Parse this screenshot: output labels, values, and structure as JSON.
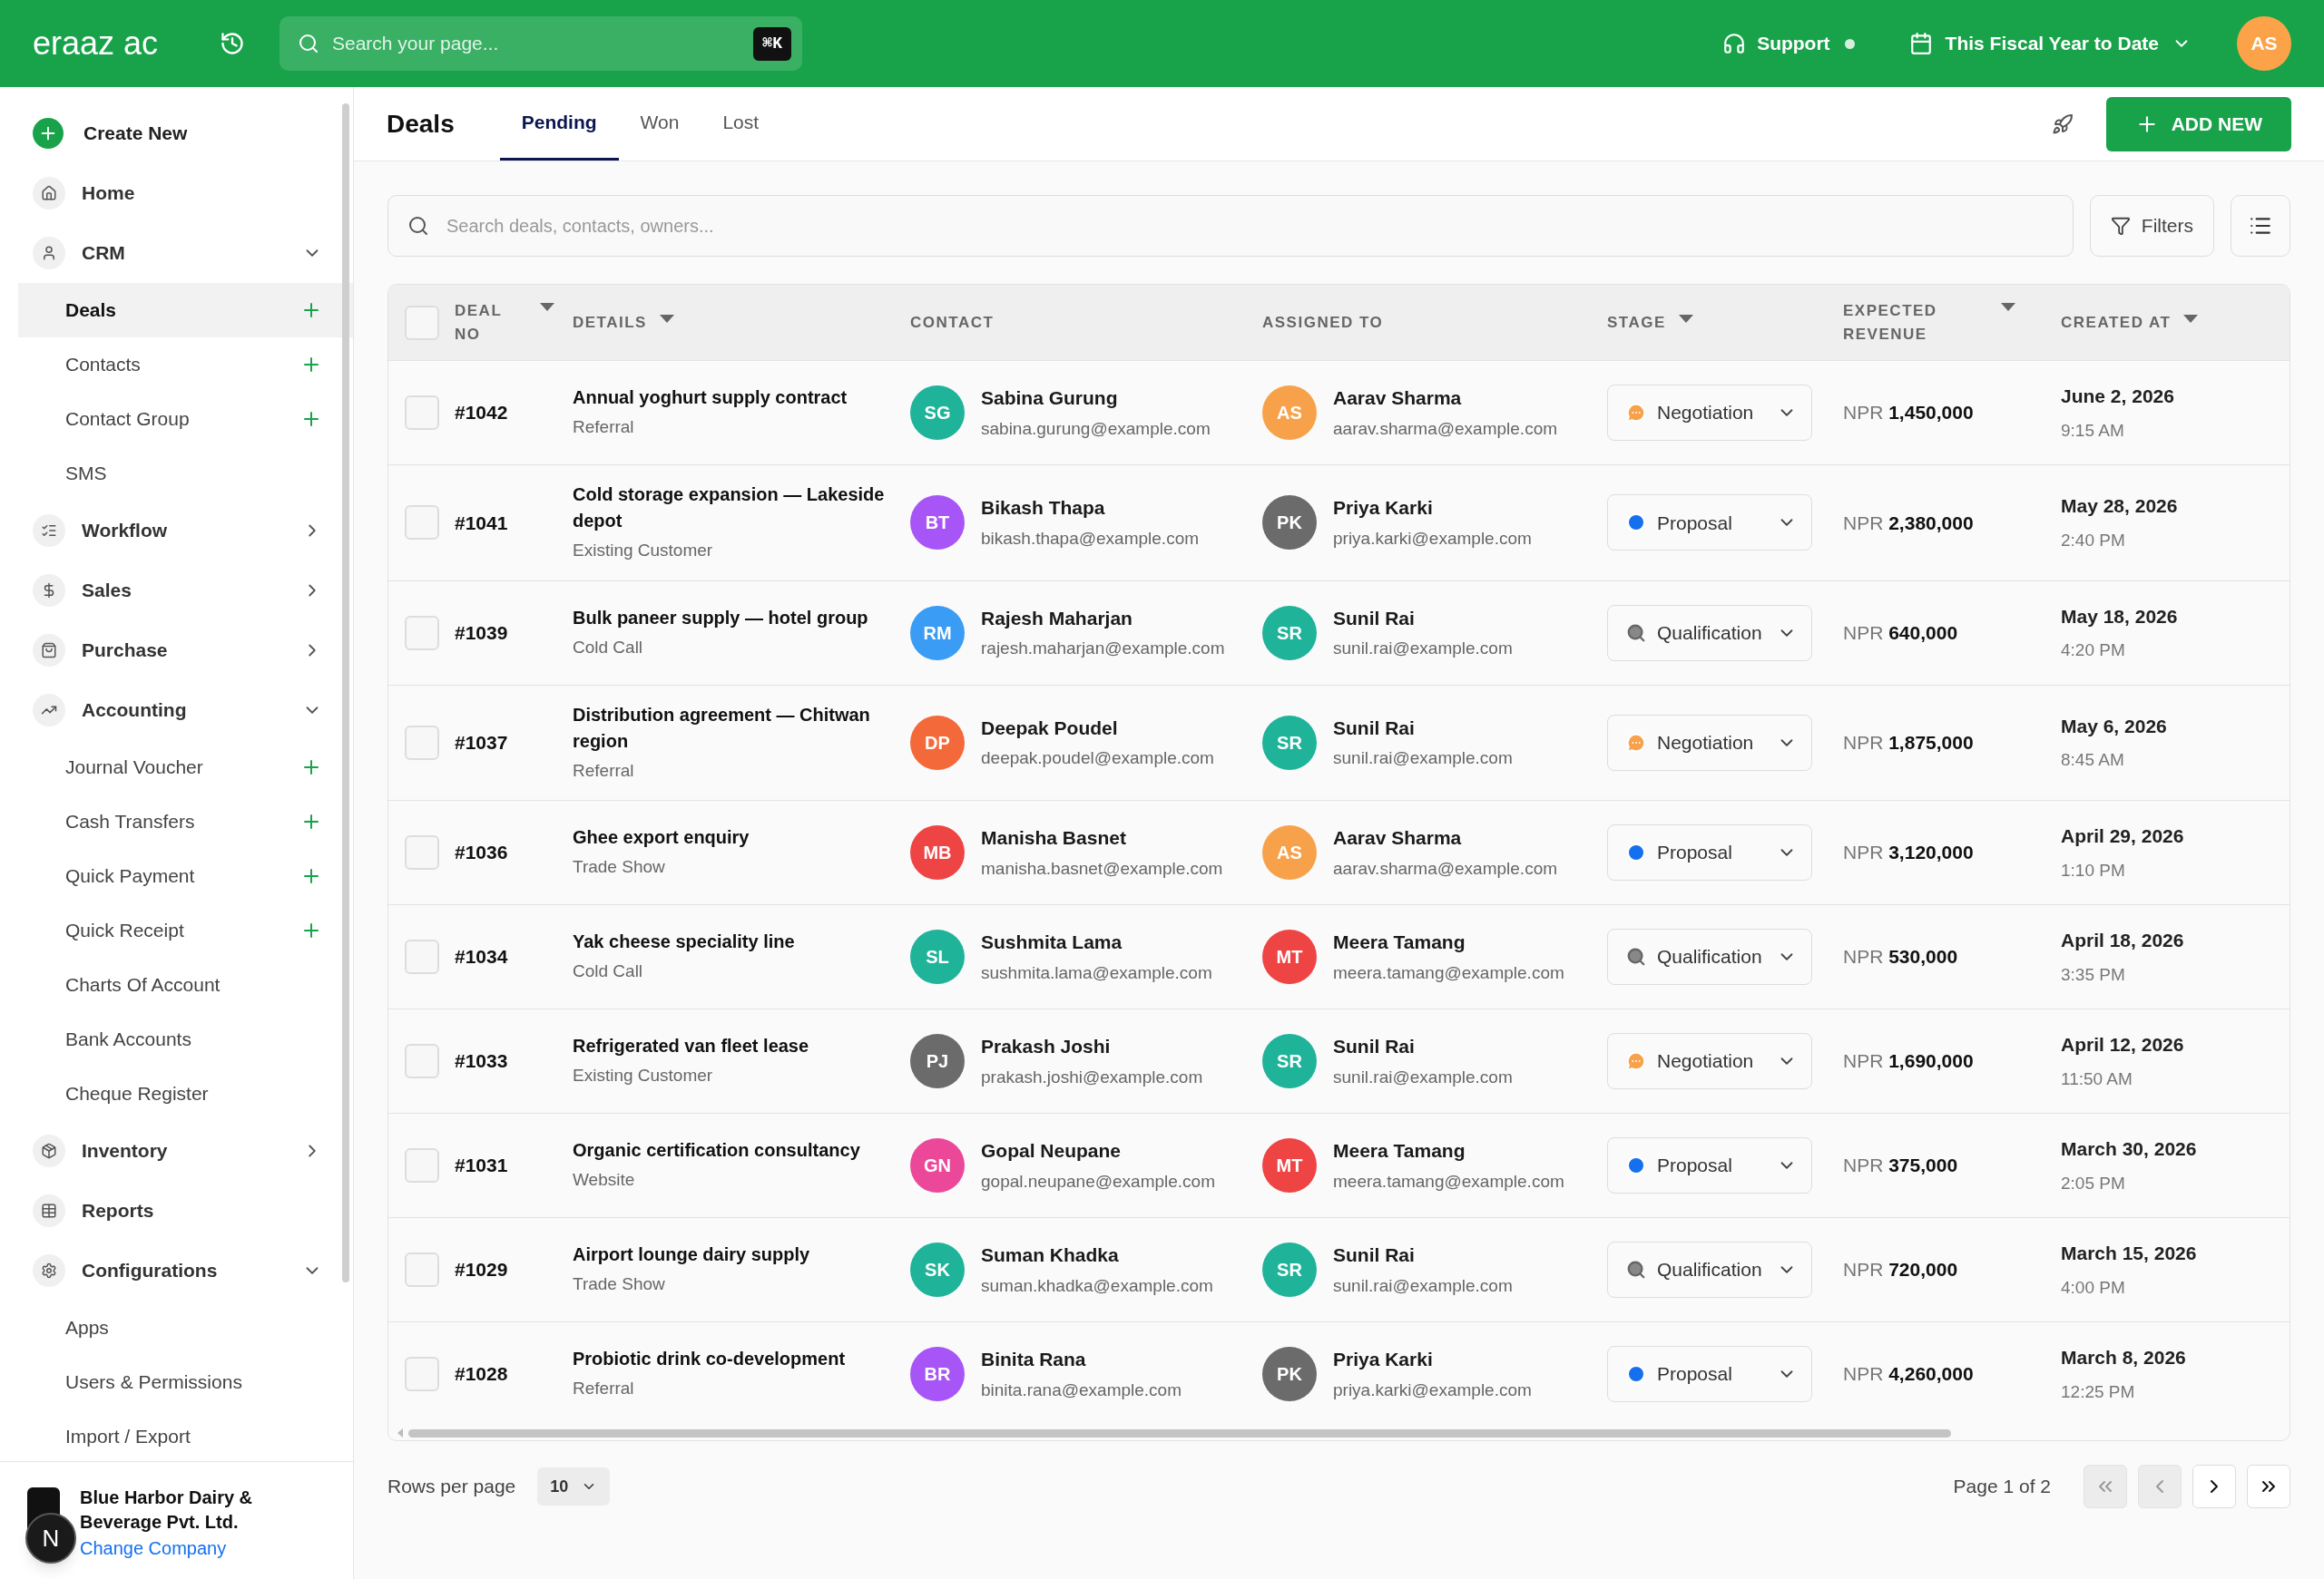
{
  "topbar": {
    "logo": "eraaz ac",
    "search": {
      "placeholder": "Search your page...",
      "shortcut": "⌘K"
    },
    "support": "Support",
    "period": "This Fiscal Year to Date",
    "user_initials": "AS"
  },
  "sidebar": {
    "create_new": "Create New",
    "items": [
      {
        "kind": "link",
        "label": "Home"
      },
      {
        "kind": "group",
        "label": "CRM",
        "expanded": true,
        "children": [
          {
            "label": "Deals",
            "selected": true,
            "add": true
          },
          {
            "label": "Contacts",
            "selected": false,
            "add": true
          },
          {
            "label": "Contact Group",
            "selected": false,
            "add": true
          },
          {
            "label": "SMS",
            "selected": false,
            "add": false
          }
        ]
      },
      {
        "kind": "group",
        "label": "Workflow",
        "expanded": false
      },
      {
        "kind": "group",
        "label": "Sales",
        "expanded": false
      },
      {
        "kind": "group",
        "label": "Purchase",
        "expanded": false
      },
      {
        "kind": "group",
        "label": "Accounting",
        "expanded": true,
        "children": [
          {
            "label": "Journal Voucher",
            "selected": false,
            "add": true
          },
          {
            "label": "Cash Transfers",
            "selected": false,
            "add": true
          },
          {
            "label": "Quick Payment",
            "selected": false,
            "add": true
          },
          {
            "label": "Quick Receipt",
            "selected": false,
            "add": true
          },
          {
            "label": "Charts Of Account",
            "selected": false,
            "add": false
          },
          {
            "label": "Bank Accounts",
            "selected": false,
            "add": false
          },
          {
            "label": "Cheque Register",
            "selected": false,
            "add": false
          }
        ]
      },
      {
        "kind": "group",
        "label": "Inventory",
        "expanded": false
      },
      {
        "kind": "link",
        "label": "Reports"
      },
      {
        "kind": "group",
        "label": "Configurations",
        "expanded": true,
        "children": [
          {
            "label": "Apps",
            "selected": false,
            "add": false
          },
          {
            "label": "Users & Permissions",
            "selected": false,
            "add": false
          },
          {
            "label": "Import / Export",
            "selected": false,
            "add": false
          }
        ]
      }
    ],
    "company": {
      "name": "Blue Harbor Dairy & Beverage Pvt. Ltd.",
      "link": "Change Company"
    },
    "dev_badge": "N"
  },
  "page": {
    "title": "Deals",
    "tabs": [
      {
        "label": "Pending",
        "selected": true
      },
      {
        "label": "Won",
        "selected": false
      },
      {
        "label": "Lost",
        "selected": false
      }
    ],
    "add_button": "ADD NEW"
  },
  "search": {
    "placeholder": "Search deals, contacts, owners..."
  },
  "filters_button": "Filters",
  "table": {
    "select_all_checked": false,
    "columns": [
      {
        "label": "DEAL NO",
        "sortable": true
      },
      {
        "label": "DETAILS",
        "sortable": true
      },
      {
        "label": "CONTACT",
        "sortable": false
      },
      {
        "label": "ASSIGNED TO",
        "sortable": false
      },
      {
        "label": "STAGE",
        "sortable": true
      },
      {
        "label": "EXPECTED REVENUE",
        "sortable": true
      },
      {
        "label": "CREATED AT",
        "sortable": true
      }
    ],
    "rows": [
      {
        "checked": false,
        "deal_no": "#1042",
        "title": "Annual yoghurt supply contract",
        "source": "Referral",
        "contact": {
          "initials": "SG",
          "color": "#1fb39a",
          "name": "Sabina Gurung",
          "email": "sabina.gurung@example.com"
        },
        "assignee": {
          "initials": "AS",
          "color": "#f7a24b",
          "name": "Aarav Sharma",
          "email": "aarav.sharma@example.com"
        },
        "stage": {
          "kind": "negotiation",
          "label": "Negotiation"
        },
        "currency": "NPR",
        "amount": "1,450,000",
        "date": "June 2, 2026",
        "time": "9:15 AM"
      },
      {
        "checked": false,
        "deal_no": "#1041",
        "title": "Cold storage expansion — Lakeside depot",
        "source": "Existing Customer",
        "contact": {
          "initials": "BT",
          "color": "#a855f7",
          "name": "Bikash Thapa",
          "email": "bikash.thapa@example.com"
        },
        "assignee": {
          "initials": "PK",
          "color": "#6b6b6b",
          "name": "Priya Karki",
          "email": "priya.karki@example.com"
        },
        "stage": {
          "kind": "proposal",
          "label": "Proposal"
        },
        "currency": "NPR",
        "amount": "2,380,000",
        "date": "May 28, 2026",
        "time": "2:40 PM"
      },
      {
        "checked": false,
        "deal_no": "#1039",
        "title": "Bulk paneer supply — hotel group",
        "source": "Cold Call",
        "contact": {
          "initials": "RM",
          "color": "#3b9cf5",
          "name": "Rajesh Maharjan",
          "email": "rajesh.maharjan@example.com"
        },
        "assignee": {
          "initials": "SR",
          "color": "#1fb39a",
          "name": "Sunil Rai",
          "email": "sunil.rai@example.com"
        },
        "stage": {
          "kind": "qualification",
          "label": "Qualification"
        },
        "currency": "NPR",
        "amount": "640,000",
        "date": "May 18, 2026",
        "time": "4:20 PM"
      },
      {
        "checked": false,
        "deal_no": "#1037",
        "title": "Distribution agreement — Chitwan region",
        "source": "Referral",
        "contact": {
          "initials": "DP",
          "color": "#f4693a",
          "name": "Deepak Poudel",
          "email": "deepak.poudel@example.com"
        },
        "assignee": {
          "initials": "SR",
          "color": "#1fb39a",
          "name": "Sunil Rai",
          "email": "sunil.rai@example.com"
        },
        "stage": {
          "kind": "negotiation",
          "label": "Negotiation"
        },
        "currency": "NPR",
        "amount": "1,875,000",
        "date": "May 6, 2026",
        "time": "8:45 AM"
      },
      {
        "checked": false,
        "deal_no": "#1036",
        "title": "Ghee export enquiry",
        "source": "Trade Show",
        "contact": {
          "initials": "MB",
          "color": "#ef4444",
          "name": "Manisha Basnet",
          "email": "manisha.basnet@example.com"
        },
        "assignee": {
          "initials": "AS",
          "color": "#f7a24b",
          "name": "Aarav Sharma",
          "email": "aarav.sharma@example.com"
        },
        "stage": {
          "kind": "proposal",
          "label": "Proposal"
        },
        "currency": "NPR",
        "amount": "3,120,000",
        "date": "April 29, 2026",
        "time": "1:10 PM"
      },
      {
        "checked": false,
        "deal_no": "#1034",
        "title": "Yak cheese speciality line",
        "source": "Cold Call",
        "contact": {
          "initials": "SL",
          "color": "#1fb39a",
          "name": "Sushmita Lama",
          "email": "sushmita.lama@example.com"
        },
        "assignee": {
          "initials": "MT",
          "color": "#ef4444",
          "name": "Meera Tamang",
          "email": "meera.tamang@example.com"
        },
        "stage": {
          "kind": "qualification",
          "label": "Qualification"
        },
        "currency": "NPR",
        "amount": "530,000",
        "date": "April 18, 2026",
        "time": "3:35 PM"
      },
      {
        "checked": false,
        "deal_no": "#1033",
        "title": "Refrigerated van fleet lease",
        "source": "Existing Customer",
        "contact": {
          "initials": "PJ",
          "color": "#6b6b6b",
          "name": "Prakash Joshi",
          "email": "prakash.joshi@example.com"
        },
        "assignee": {
          "initials": "SR",
          "color": "#1fb39a",
          "name": "Sunil Rai",
          "email": "sunil.rai@example.com"
        },
        "stage": {
          "kind": "negotiation",
          "label": "Negotiation"
        },
        "currency": "NPR",
        "amount": "1,690,000",
        "date": "April 12, 2026",
        "time": "11:50 AM"
      },
      {
        "checked": false,
        "deal_no": "#1031",
        "title": "Organic certification consultancy",
        "source": "Website",
        "contact": {
          "initials": "GN",
          "color": "#ec4899",
          "name": "Gopal Neupane",
          "email": "gopal.neupane@example.com"
        },
        "assignee": {
          "initials": "MT",
          "color": "#ef4444",
          "name": "Meera Tamang",
          "email": "meera.tamang@example.com"
        },
        "stage": {
          "kind": "proposal",
          "label": "Proposal"
        },
        "currency": "NPR",
        "amount": "375,000",
        "date": "March 30, 2026",
        "time": "2:05 PM"
      },
      {
        "checked": false,
        "deal_no": "#1029",
        "title": "Airport lounge dairy supply",
        "source": "Trade Show",
        "contact": {
          "initials": "SK",
          "color": "#1fb39a",
          "name": "Suman Khadka",
          "email": "suman.khadka@example.com"
        },
        "assignee": {
          "initials": "SR",
          "color": "#1fb39a",
          "name": "Sunil Rai",
          "email": "sunil.rai@example.com"
        },
        "stage": {
          "kind": "qualification",
          "label": "Qualification"
        },
        "currency": "NPR",
        "amount": "720,000",
        "date": "March 15, 2026",
        "time": "4:00 PM"
      },
      {
        "checked": false,
        "deal_no": "#1028",
        "title": "Probiotic drink co-development",
        "source": "Referral",
        "contact": {
          "initials": "BR",
          "color": "#a855f7",
          "name": "Binita Rana",
          "email": "binita.rana@example.com"
        },
        "assignee": {
          "initials": "PK",
          "color": "#6b6b6b",
          "name": "Priya Karki",
          "email": "priya.karki@example.com"
        },
        "stage": {
          "kind": "proposal",
          "label": "Proposal"
        },
        "currency": "NPR",
        "amount": "4,260,000",
        "date": "March 8, 2026",
        "time": "12:25 PM"
      }
    ]
  },
  "footer": {
    "rows_label": "Rows per page",
    "rows_value": "10",
    "page_label": "Page 1 of 2",
    "buttons": [
      {
        "kind": "first",
        "disabled": true
      },
      {
        "kind": "prev",
        "disabled": true
      },
      {
        "kind": "next",
        "disabled": false
      },
      {
        "kind": "last",
        "disabled": false
      }
    ]
  }
}
